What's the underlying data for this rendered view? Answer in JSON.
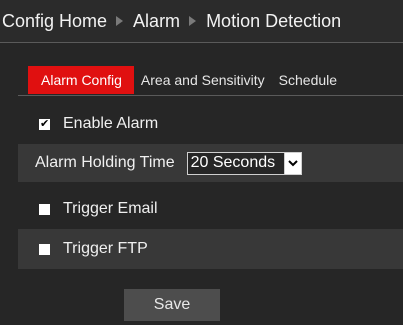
{
  "breadcrumb": {
    "items": [
      "Config Home",
      "Alarm",
      "Motion Detection"
    ]
  },
  "tabs": [
    {
      "label": "Alarm Config",
      "active": true
    },
    {
      "label": "Area and Sensitivity",
      "active": false
    },
    {
      "label": "Schedule",
      "active": false
    }
  ],
  "form": {
    "enable_alarm": {
      "label": "Enable Alarm",
      "checked": true
    },
    "alarm_holding_time": {
      "label": "Alarm Holding Time",
      "value": "20 Seconds"
    },
    "trigger_email": {
      "label": "Trigger Email",
      "checked": false
    },
    "trigger_ftp": {
      "label": "Trigger FTP",
      "checked": false
    }
  },
  "save_label": "Save",
  "colors": {
    "background": "#262626",
    "active_tab": "#e01010",
    "shaded_row": "#383838",
    "button": "#4d4d4d"
  },
  "icons": {
    "breadcrumb_separator": "triangle-right-icon",
    "checkbox_tick": "checkmark-icon",
    "dropdown": "chevron-down-icon"
  }
}
